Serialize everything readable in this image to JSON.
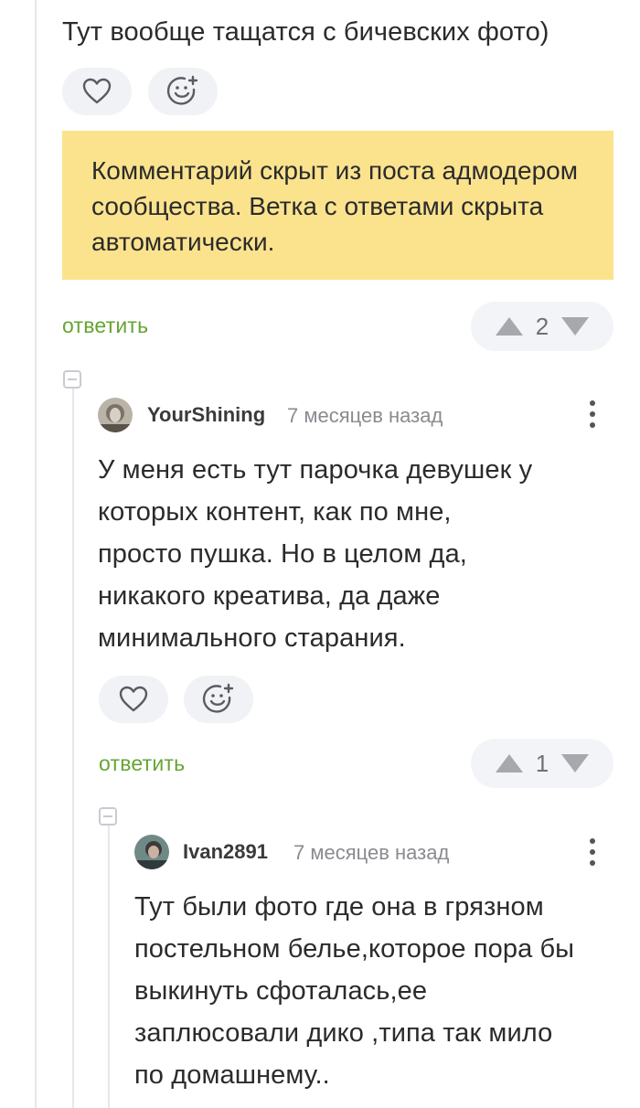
{
  "top_comment": {
    "text": "Тут вообще тащатся с бичевских фото)"
  },
  "hidden_notice": {
    "text": "Комментарий скрыт из поста адмодером сообщества. Ветка с ответами скрыта автоматически."
  },
  "reply_label": "ответить",
  "comment_1": {
    "vote_count": "2"
  },
  "comment_2": {
    "username": "YourShining",
    "time": "7 месяцев назад",
    "lines": [
      "У меня есть тут парочка девушек у",
      "которых контент, как по мне,",
      "просто пушка. Но в целом да,",
      "никакого креатива, да даже",
      "минимального старания."
    ],
    "vote_count": "1"
  },
  "comment_3": {
    "username": "Ivan2891",
    "time": "7 месяцев назад",
    "lines": [
      "Тут были фото где она в грязном",
      "постельном белье,которое пора бы",
      "выкинуть сфоталась,ее",
      "заплюсовали дико ,типа так мило",
      "по домашнему.."
    ]
  },
  "icons": {
    "like": "heart-icon",
    "emoji": "smiley-plus-icon",
    "up": "triangle-up-icon",
    "down": "triangle-down-icon",
    "menu": "more-vertical-icon",
    "collapse": "collapse-minus-icon"
  },
  "colors": {
    "accent_green": "#65a532",
    "notice_bg": "#fbe38e",
    "pill_bg": "#f1f2f6"
  }
}
